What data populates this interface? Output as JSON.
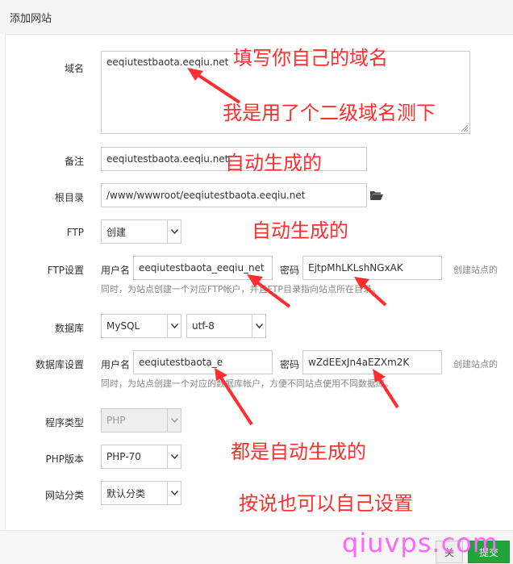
{
  "dialog": {
    "title": "添加网站"
  },
  "form": {
    "domain": {
      "label": "域名",
      "value": "eeqiutestbaota.eeqiu.net"
    },
    "remark": {
      "label": "备注",
      "value": "eeqiutestbaota.eeqiu.net"
    },
    "root": {
      "label": "根目录",
      "value": "/www/wwwroot/eeqiutestbaota.eeqiu.net"
    },
    "ftp": {
      "label": "FTP",
      "value": "创建"
    },
    "ftp_settings": {
      "label": "FTP设置",
      "username_label": "用户名",
      "username": "eeqiutestbaota_eeqiu_net",
      "password_label": "密码",
      "password": "EjtpMhLKLshNGxAK",
      "note_right": "创建站点的",
      "help": "同时，为站点创建一个对应FTP帐户，并且FTP目录指向站点所在目录。"
    },
    "database": {
      "label": "数据库",
      "type": "MySQL",
      "charset": "utf-8"
    },
    "db_settings": {
      "label": "数据库设置",
      "username_label": "用户名",
      "username": "eeqiutestbaota_e",
      "password_label": "密码",
      "password": "wZdEExJn4aEZXm2K",
      "note_right": "创建站点的",
      "help": "同时，为站点创建一个对应的数据库帐户，方便不同站点使用不同数据库。"
    },
    "program_type": {
      "label": "程序类型",
      "value": "PHP"
    },
    "php_version": {
      "label": "PHP版本",
      "value": "PHP-70"
    },
    "category": {
      "label": "网站分类",
      "value": "默认分类"
    }
  },
  "annotations": {
    "a1": "填写你自己的域名",
    "a2": "我是用了个二级域名测下",
    "a3": "自动生成的",
    "a4": "自动生成的",
    "a5": "都是自动生成的",
    "a6": "按说也可以自己设置"
  },
  "footer": {
    "cancel": "关",
    "submit": "提交"
  },
  "watermark": "qiuvps.com",
  "colors": {
    "annotation": "#ff2f2f",
    "submit": "#20a53a",
    "watermark": "#ff66ff"
  }
}
